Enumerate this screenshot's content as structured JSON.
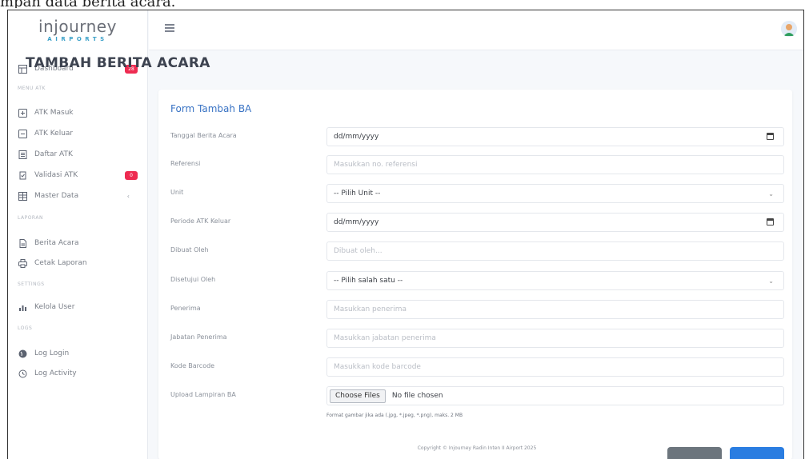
{
  "caption": "mpan data berita acara.",
  "brand": {
    "name": "injourney",
    "sub": "AIRPORTS"
  },
  "sidebar": {
    "items": [
      {
        "label": "Dashboard",
        "icon": "dashboard-icon",
        "badge": "28"
      },
      {
        "label": "ATK Masuk",
        "icon": "inbox-in-icon"
      },
      {
        "label": "ATK Keluar",
        "icon": "inbox-out-icon"
      },
      {
        "label": "Daftar ATK",
        "icon": "list-icon"
      },
      {
        "label": "Validasi ATK",
        "icon": "checklist-icon",
        "badge": "0"
      },
      {
        "label": "Master Data",
        "icon": "database-icon",
        "chevron": "‹"
      },
      {
        "label": "Berita Acara",
        "icon": "document-icon"
      },
      {
        "label": "Cetak Laporan",
        "icon": "printer-icon"
      },
      {
        "label": "Kelola User",
        "icon": "users-icon"
      },
      {
        "label": "Log Login",
        "icon": "globe-icon"
      },
      {
        "label": "Log Activity",
        "icon": "history-icon"
      }
    ],
    "sections": [
      "MENU ATK",
      "LAPORAN",
      "SETTINGS",
      "LOGS"
    ]
  },
  "page": {
    "title": "TAMBAH BERITA ACARA"
  },
  "form": {
    "title": "Form Tambah BA",
    "fields": [
      {
        "label": "Tanggal Berita Acara",
        "value": "dd/mm/yyyy",
        "type": "date"
      },
      {
        "label": "Referensi",
        "placeholder": "Masukkan no. referensi"
      },
      {
        "label": "Unit",
        "value": "-- Pilih Unit --",
        "type": "select"
      },
      {
        "label": "Periode ATK Keluar",
        "value": "dd/mm/yyyy",
        "type": "date"
      },
      {
        "label": "Dibuat Oleh",
        "placeholder": "Dibuat oleh..."
      },
      {
        "label": "Disetujui Oleh",
        "value": "-- Pilih salah satu --",
        "type": "select"
      },
      {
        "label": "Penerima",
        "placeholder": "Masukkan penerima"
      },
      {
        "label": "Jabatan Penerima",
        "placeholder": "Masukkan jabatan penerima"
      },
      {
        "label": "Kode Barcode",
        "placeholder": "Masukkan kode barcode"
      },
      {
        "label": "Upload Lampiran BA",
        "type": "file",
        "button": "Choose Files",
        "status": "No file chosen"
      }
    ],
    "hint": "Format gambar jika ada (.jpg, *.jpeg, *.png), maks. 2 MB"
  },
  "footer": {
    "text": "Copyright © Injourney Radin Inten II Airport 2025"
  },
  "colors": {
    "accent": "#2a7de1",
    "badge": "#ee2b51",
    "title": "#3973c4"
  }
}
